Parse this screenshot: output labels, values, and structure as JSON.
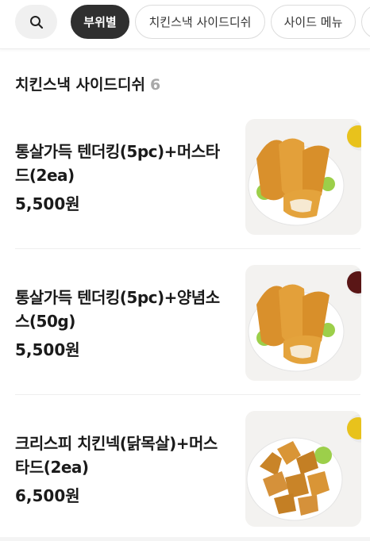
{
  "filters": {
    "chips": [
      {
        "label": "부위별",
        "active": true
      },
      {
        "label": "치킨스낵 사이드디쉬",
        "active": false
      },
      {
        "label": "사이드 메뉴",
        "active": false
      }
    ]
  },
  "section": {
    "title": "치킨스낵 사이드디쉬",
    "count": "6"
  },
  "items": [
    {
      "name_line1": "통살가득 텐더킹(5pc)+머스타",
      "name_line2": "드(2ea)",
      "price": "5,500원",
      "image": "tender-chicken-with-mustard",
      "sauce_color": "#e8c21c"
    },
    {
      "name_line1": "통살가득 텐더킹(5pc)+양념소",
      "name_line2": "스(50g)",
      "price": "5,500원",
      "image": "tender-chicken-with-yangnyeom-sauce",
      "sauce_color": "#5a1616"
    },
    {
      "name_line1": "크리스피 치킨넥(닭목살)+머스",
      "name_line2": "타드(2ea)",
      "price": "6,500원",
      "image": "crispy-chicken-neck-with-mustard",
      "sauce_color": "#e8c21c"
    }
  ]
}
